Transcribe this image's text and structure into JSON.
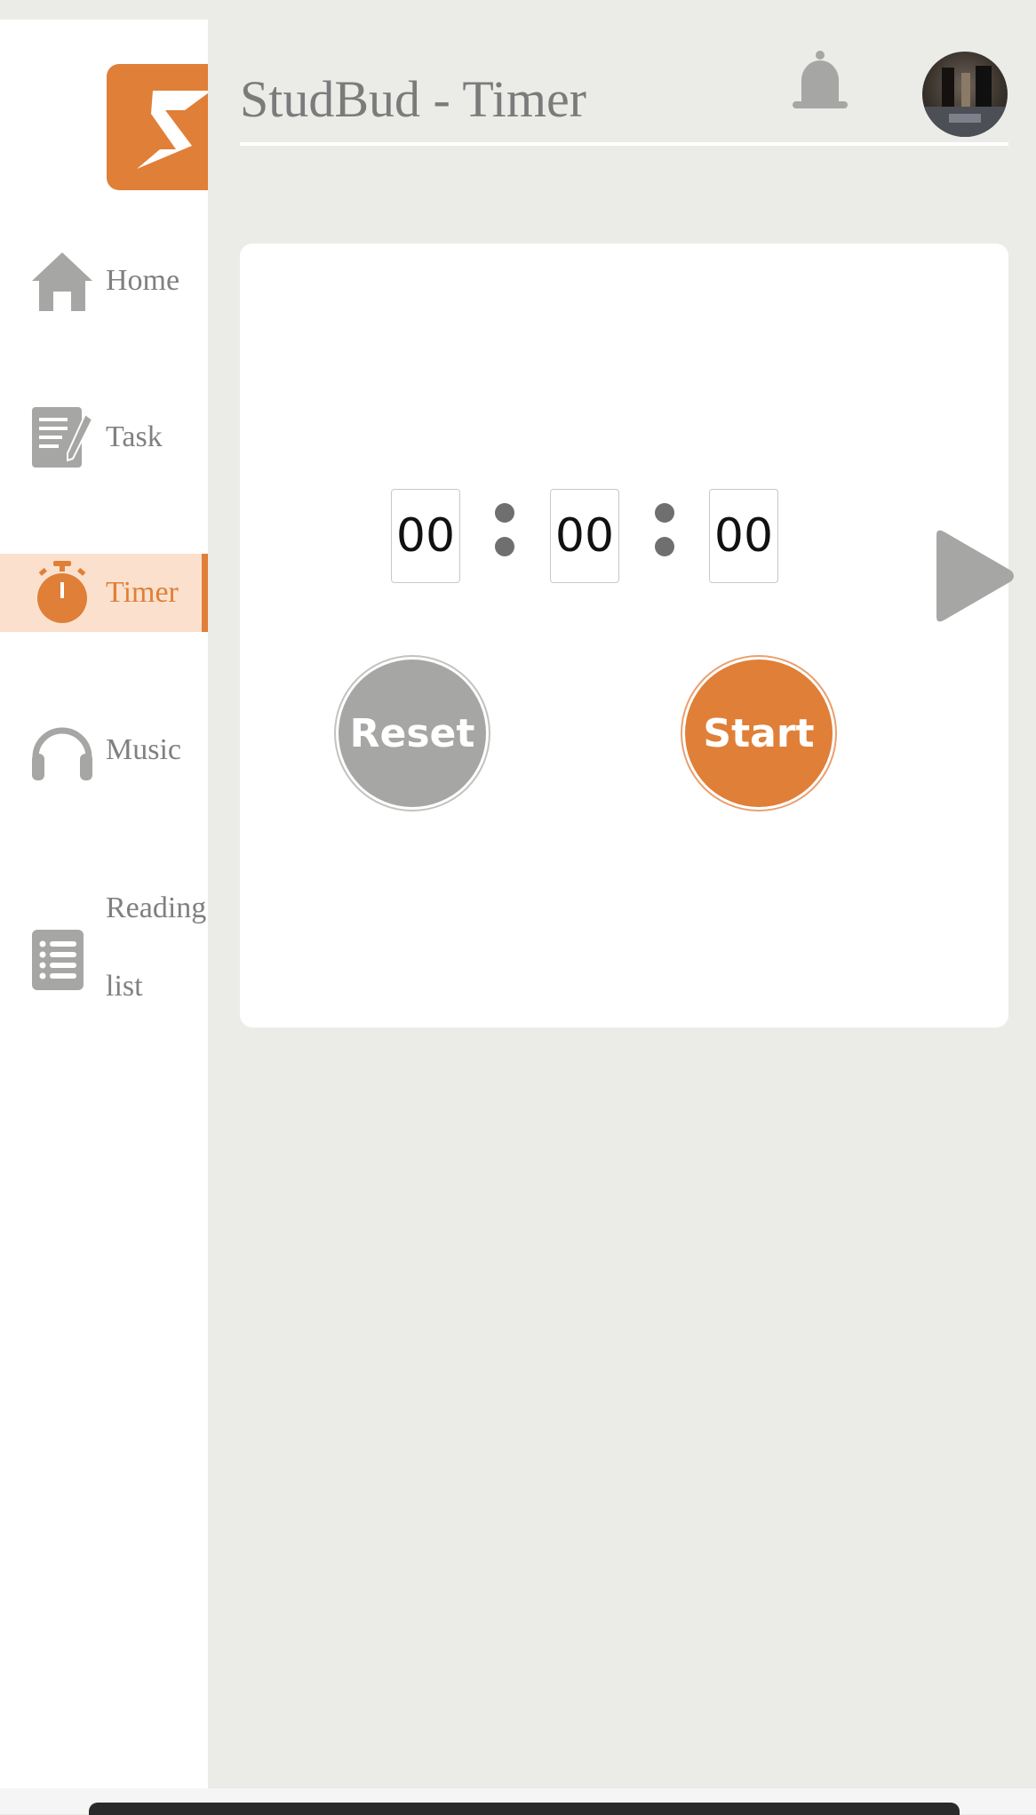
{
  "app": {
    "title": "StudBud - Timer",
    "accent_color": "#e07f38",
    "logo_icon": "studbud-s-logo"
  },
  "header": {
    "notification_icon": "bell-icon",
    "avatar_icon": "user-avatar"
  },
  "sidebar": {
    "items": [
      {
        "label": "Home",
        "icon": "home-icon",
        "active": false
      },
      {
        "label": "Task",
        "icon": "task-notes-icon",
        "active": false
      },
      {
        "label": "Timer",
        "icon": "stopwatch-icon",
        "active": true
      },
      {
        "label": "Music",
        "icon": "headphones-icon",
        "active": false
      },
      {
        "label_line1": "Reading",
        "label_line2": "list",
        "icon": "list-icon",
        "active": false
      }
    ]
  },
  "timer": {
    "hours": "00",
    "minutes": "00",
    "seconds": "00",
    "reset_label": "Reset",
    "start_label": "Start",
    "next_icon": "play-next-icon"
  }
}
